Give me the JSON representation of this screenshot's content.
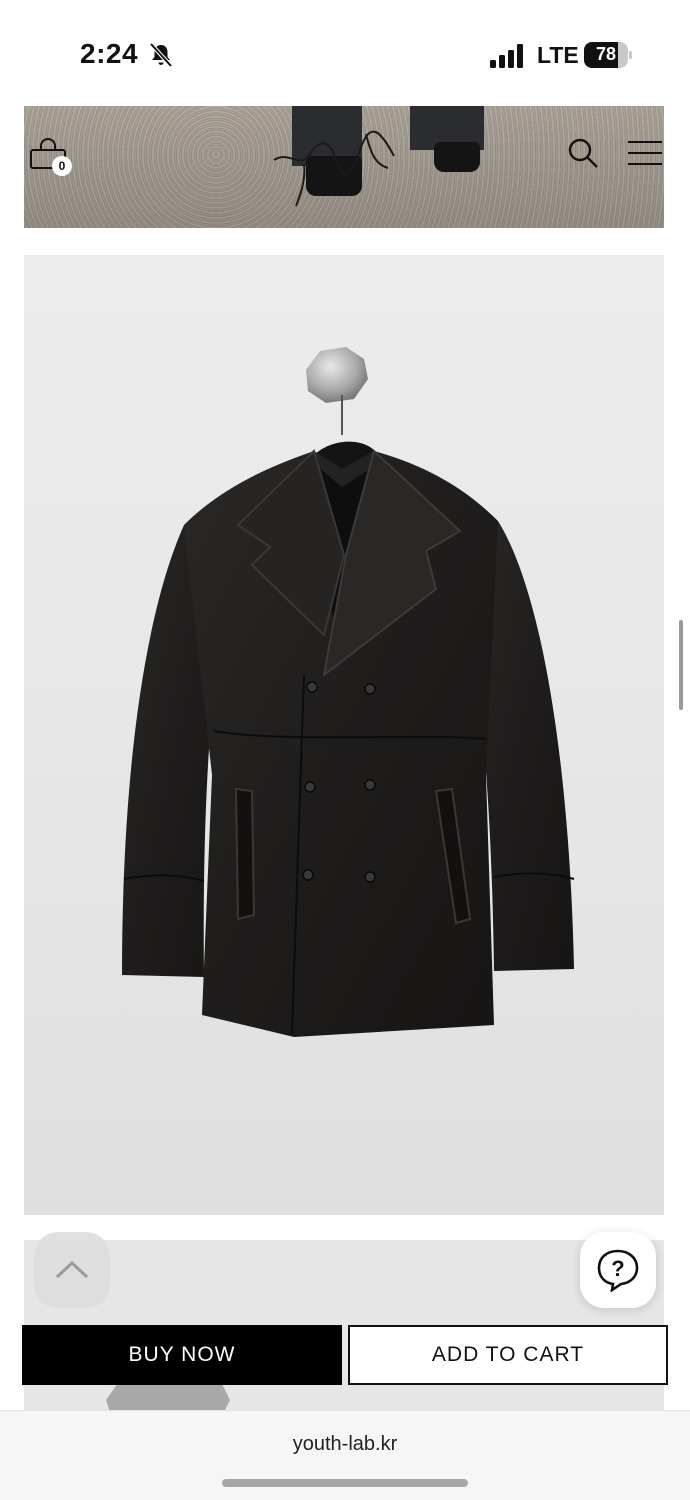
{
  "status_bar": {
    "time": "2:24",
    "network": "LTE",
    "battery_level": "78",
    "battery_fraction": 0.78
  },
  "header": {
    "cart_count": "0",
    "icons": [
      "cart-icon",
      "youth-logo",
      "search-icon",
      "menu-icon"
    ]
  },
  "actions": {
    "buy_now_label": "BUY NOW",
    "add_to_cart_label": "ADD TO CART"
  },
  "browser": {
    "url": "youth-lab.kr"
  },
  "colors": {
    "primary_button": "#000000",
    "secondary_button_border": "#111111",
    "image_background": "#e7e7e8"
  }
}
